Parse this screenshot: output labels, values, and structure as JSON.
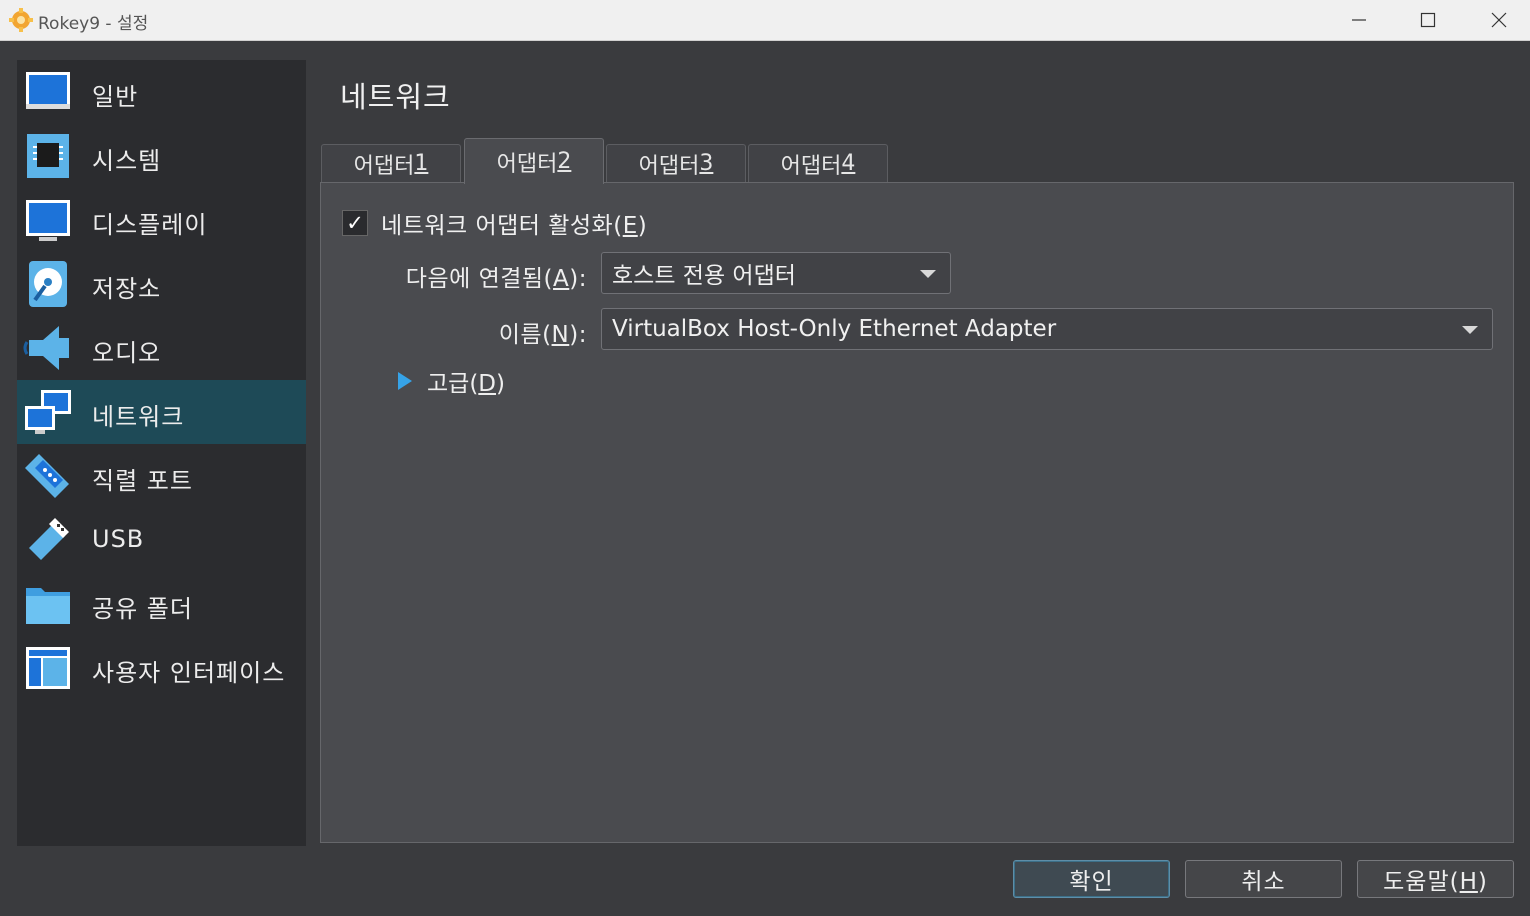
{
  "window": {
    "title": "Rokey9 - 설정",
    "icon": "gear-icon",
    "controls": {
      "minimize": "minimize-icon",
      "maximize": "maximize-icon",
      "close": "close-icon"
    }
  },
  "sidebar": {
    "items": [
      {
        "label": "일반",
        "icon": "general-monitor-icon"
      },
      {
        "label": "시스템",
        "icon": "chip-icon"
      },
      {
        "label": "디스플레이",
        "icon": "display-icon"
      },
      {
        "label": "저장소",
        "icon": "storage-disk-icon"
      },
      {
        "label": "오디오",
        "icon": "speaker-icon"
      },
      {
        "label": "네트워크",
        "icon": "network-icon",
        "active": true
      },
      {
        "label": "직렬 포트",
        "icon": "serial-port-icon"
      },
      {
        "label": "USB",
        "icon": "usb-icon"
      },
      {
        "label": "공유 폴더",
        "icon": "folder-icon"
      },
      {
        "label": "사용자 인터페이스",
        "icon": "user-interface-icon"
      }
    ]
  },
  "main": {
    "title": "네트워크",
    "tabs": [
      {
        "label": "어댑터 ",
        "mnemonic": "1"
      },
      {
        "label": "어댑터 ",
        "mnemonic": "2",
        "active": true
      },
      {
        "label": "어댑터 ",
        "mnemonic": "3"
      },
      {
        "label": "어댑터 ",
        "mnemonic": "4"
      }
    ],
    "enable_adapter": {
      "label_prefix": "네트워크 어댑터 활성화(",
      "mnemonic": "E",
      "label_suffix": ")",
      "checked": true,
      "check_glyph": "✓"
    },
    "attached_to": {
      "label_prefix": "다음에 연결됨(",
      "mnemonic": "A",
      "label_suffix": "):",
      "value": "호스트 전용 어댑터"
    },
    "name": {
      "label_prefix": "이름(",
      "mnemonic": "N",
      "label_suffix": "):",
      "value": "VirtualBox Host-Only Ethernet Adapter"
    },
    "advanced": {
      "label_prefix": "고급(",
      "mnemonic": "D",
      "label_suffix": ")"
    }
  },
  "buttons": {
    "ok": "확인",
    "cancel": "취소",
    "help_prefix": "도움말(",
    "help_mnemonic": "H",
    "help_suffix": ")"
  },
  "colors": {
    "accent": "#36a3e8",
    "active_sidebar": "#1e4a57",
    "background": "#3a3b3e"
  }
}
